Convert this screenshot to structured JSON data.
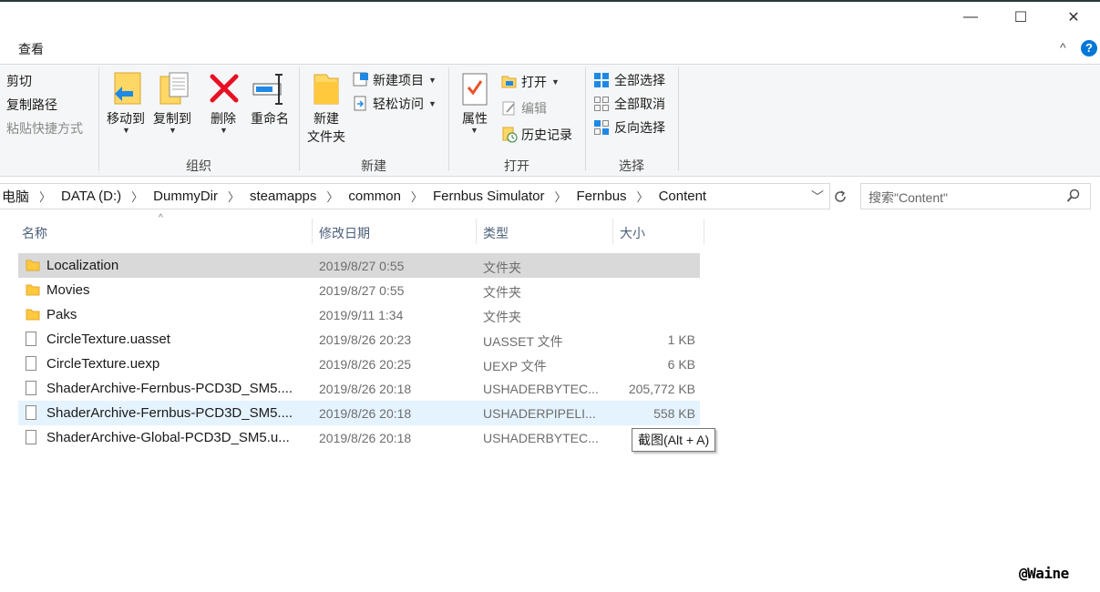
{
  "window": {
    "minimize": "—",
    "maximize": "☐",
    "close": "✕"
  },
  "ribbon_tabs": {
    "view": "查看",
    "collapse": "^",
    "help": "?"
  },
  "clipboard": {
    "cut": "剪切",
    "copy_path": "复制路径",
    "paste_shortcut": "粘贴快捷方式"
  },
  "organize": {
    "move_to": "移动到",
    "copy_to": "复制到",
    "delete": "删除",
    "rename": "重命名",
    "label": "组织"
  },
  "new": {
    "new_folder_line1": "新建",
    "new_folder_line2": "文件夹",
    "new_item": "新建项目",
    "easy_access": "轻松访问",
    "label": "新建"
  },
  "open": {
    "properties": "属性",
    "open": "打开",
    "edit": "编辑",
    "history": "历史记录",
    "label": "打开"
  },
  "select": {
    "select_all": "全部选择",
    "select_none": "全部取消",
    "invert": "反向选择",
    "label": "选择"
  },
  "address": {
    "crumbs": [
      "电脑",
      "DATA (D:)",
      "DummyDir",
      "steamapps",
      "common",
      "Fernbus Simulator",
      "Fernbus",
      "Content"
    ]
  },
  "search": {
    "placeholder": "搜索\"Content\""
  },
  "columns": {
    "name": "名称",
    "date": "修改日期",
    "type": "类型",
    "size": "大小"
  },
  "files": [
    {
      "kind": "folder",
      "name": "Localization",
      "date": "2019/8/27 0:55",
      "type": "文件夹",
      "size": "",
      "state": "selected"
    },
    {
      "kind": "folder",
      "name": "Movies",
      "date": "2019/8/27 0:55",
      "type": "文件夹",
      "size": "",
      "state": ""
    },
    {
      "kind": "folder",
      "name": "Paks",
      "date": "2019/9/11 1:34",
      "type": "文件夹",
      "size": "",
      "state": ""
    },
    {
      "kind": "file",
      "name": "CircleTexture.uasset",
      "date": "2019/8/26 20:23",
      "type": "UASSET 文件",
      "size": "1 KB",
      "state": ""
    },
    {
      "kind": "file",
      "name": "CircleTexture.uexp",
      "date": "2019/8/26 20:25",
      "type": "UEXP 文件",
      "size": "6 KB",
      "state": ""
    },
    {
      "kind": "file",
      "name": "ShaderArchive-Fernbus-PCD3D_SM5....",
      "date": "2019/8/26 20:18",
      "type": "USHADERBYTEC...",
      "size": "205,772 KB",
      "state": ""
    },
    {
      "kind": "file",
      "name": "ShaderArchive-Fernbus-PCD3D_SM5....",
      "date": "2019/8/26 20:18",
      "type": "USHADERPIPELI...",
      "size": "558 KB",
      "state": "hover"
    },
    {
      "kind": "file",
      "name": "ShaderArchive-Global-PCD3D_SM5.u...",
      "date": "2019/8/26 20:18",
      "type": "USHADERBYTEC...",
      "size": "",
      "state": ""
    }
  ],
  "tooltip": "截图(Alt + A)",
  "watermark": "@Waine",
  "colors": {
    "accent": "#0078d7",
    "selected_row": "#d9d9d9",
    "hover_row": "#e5f3ff",
    "folder": "#ffd764",
    "delete": "#e81123"
  }
}
